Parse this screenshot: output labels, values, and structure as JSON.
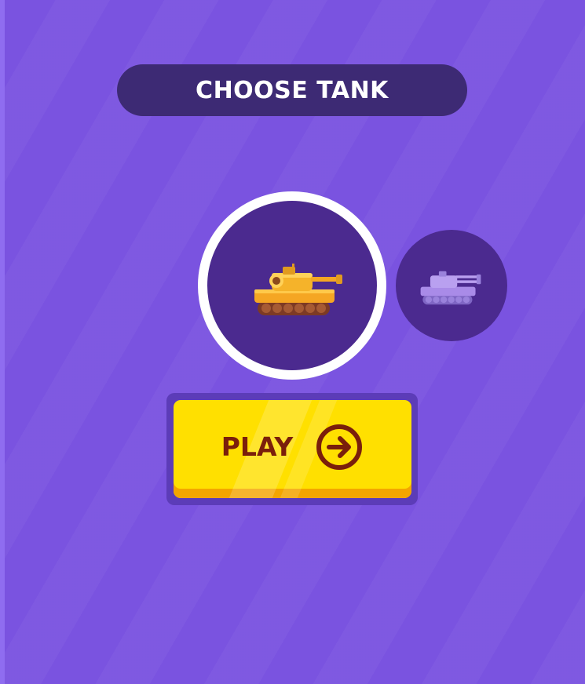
{
  "title": "CHOOSE TANK",
  "tanks": [
    {
      "name": "yellow-tank",
      "state": "selected",
      "color": "#f5b32a"
    },
    {
      "name": "lavender-tank",
      "state": "unselected",
      "color": "#a98be8"
    }
  ],
  "play_button": {
    "label": "PLAY",
    "icon": "arrow-right-circle-icon"
  },
  "colors": {
    "background": "#7a53e0",
    "title_bar": "#3d2a74",
    "tank_slot": "#4b2a8f",
    "button_face": "#ffe000",
    "button_shadow": "#f4a500",
    "button_text": "#7a1f0b"
  }
}
